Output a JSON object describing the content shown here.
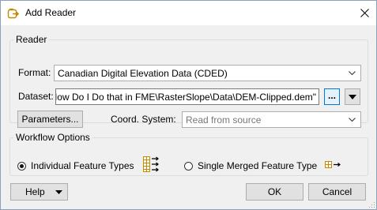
{
  "window": {
    "title": "Add Reader"
  },
  "reader": {
    "legend": "Reader",
    "format_label": "Format:",
    "format_value": "Canadian Digital Elevation Data (CDED)",
    "dataset_label": "Dataset:",
    "dataset_value": "How Do I Do that in FME\\RasterSlope\\Data\\DEM-Clipped.dem\"",
    "browse_label": "...",
    "parameters_label": "Parameters...",
    "coord_label": "Coord. System:",
    "coord_placeholder": "Read from source"
  },
  "workflow": {
    "legend": "Workflow Options",
    "option1_label": "Individual Feature Types",
    "option1_selected": true,
    "option2_label": "Single Merged Feature Type",
    "option2_selected": false
  },
  "footer": {
    "help_label": "Help",
    "ok_label": "OK",
    "cancel_label": "Cancel"
  },
  "icons": {
    "app": "add-reader-icon",
    "close": "close-icon",
    "dropdown": "chevron-down-icon",
    "grid_multi": "feature-types-multi-icon",
    "grid_single": "feature-type-single-icon"
  },
  "colors": {
    "accent": "#0078d7",
    "icon_gold": "#c28a00"
  }
}
